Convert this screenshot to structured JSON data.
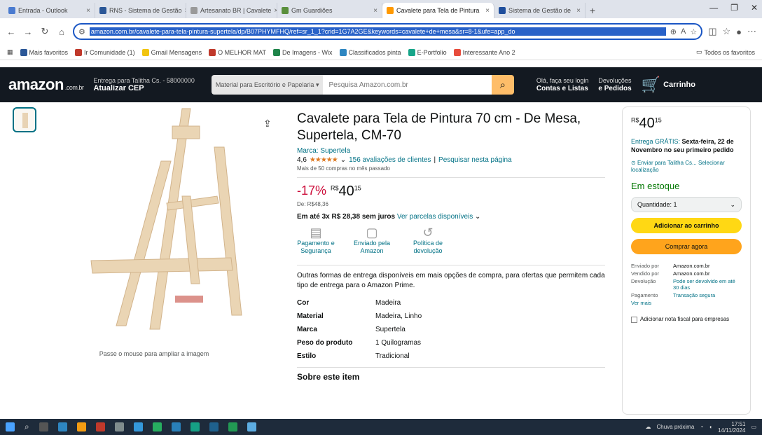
{
  "browser": {
    "tabs": [
      {
        "label": "Entrada - Outlook",
        "active": false
      },
      {
        "label": "RNS - Sistema de Gestão",
        "active": false
      },
      {
        "label": "Artesanato BR | Cavalete",
        "active": false
      },
      {
        "label": "Gm Guardiões",
        "active": false
      },
      {
        "label": "Cavalete para Tela de Pintura",
        "active": true
      },
      {
        "label": "Sistema de Gestão de",
        "active": false
      }
    ],
    "url": "amazon.com.br/cavalete-para-tela-pintura-supertela/dp/B07PHYMFHQ/ref=sr_1_1?crid=1G7A2GE&keywords=cavalete+de+mesa&sr=8-1&ufe=app_do",
    "bookmarks": [
      "Mais favoritos",
      "Ir Comunidade (1)",
      "Gmail Mensagens",
      "O MELHOR MAT",
      "De Imagens - Wix",
      "Classificados pinta",
      "E-Portfolio",
      "Interessante Ano 2"
    ],
    "bookmarks_right": "Todos os favoritos"
  },
  "header": {
    "logo": "amazon",
    "logo_suffix": ".com.br",
    "deliver_line1": "Entrega para Talitha Cs. - 58000000",
    "deliver_line2": "Atualizar CEP",
    "search_category": "Material para Escritório e Papelaria",
    "search_placeholder": "Pesquisa Amazon.com.br",
    "account_line1": "Olá, faça seu login",
    "account_line2": "Contas e Listas",
    "orders_line1": "Devoluções",
    "orders_line2": "e Pedidos",
    "cart_label": "Carrinho",
    "cart_count": "0"
  },
  "product": {
    "title": "Cavalete para Tela de Pintura 70 cm - De Mesa, Supertela, CM-70",
    "brand_link": "Marca: Supertela",
    "rating_value": "4,6",
    "stars": "★★★★★",
    "reviews_link": "156 avaliações de clientes",
    "search_page_link": "Pesquisar nesta página",
    "bought": "Mais de 50 compras no mês passado",
    "discount": "-17%",
    "price_currency": "R$",
    "price_whole": "40",
    "price_cents": "15",
    "old_price": "De: R$48,36",
    "installments": "Em até 3x R$ 28,38 sem juros",
    "installments_link": "Ver parcelas disponíveis",
    "features": [
      {
        "icon": "credit-card-icon",
        "glyph": "▤",
        "label": "Pagamento e Segurança"
      },
      {
        "icon": "box-icon",
        "glyph": "▢",
        "label": "Enviado pela Amazon"
      },
      {
        "icon": "return-icon",
        "glyph": "↺",
        "label": "Política de devolução"
      }
    ],
    "note_text": "Outras formas de entrega disponíveis em mais opções de compra, para ofertas que permitem cada tipo de entrega para o Amazon Prime.",
    "note_link": "mais opções de compra",
    "specs": [
      {
        "key": "Cor",
        "value": "Madeira"
      },
      {
        "key": "Material",
        "value": "Madeira, Linho"
      },
      {
        "key": "Marca",
        "value": "Supertela"
      },
      {
        "key": "Peso do produto",
        "value": "1 Quilogramas"
      },
      {
        "key": "Estilo",
        "value": "Tradicional"
      }
    ],
    "about_heading": "Sobre este item",
    "zoom_hint": "Passe o mouse para ampliar a imagem"
  },
  "buybox": {
    "price_currency": "R$",
    "price_whole": "40",
    "price_cents": "15",
    "delivery_link": "Entrega GRÁTIS:",
    "delivery_text": "Sexta-feira, 22 de Novembro no seu primeiro pedido",
    "location": "Enviar para Talitha Cs... Selecionar localização",
    "stock": "Em estoque",
    "qty_label": "Quantidade: 1",
    "add_cart": "Adicionar ao carrinho",
    "buy_now": "Comprar agora",
    "info": [
      {
        "k": "Enviado por",
        "v": "Amazon.com.br",
        "link": false
      },
      {
        "k": "Vendido por",
        "v": "Amazon.com.br",
        "link": false
      },
      {
        "k": "Devolução",
        "v": "Pode ser devolvido em até 30 dias",
        "link": true
      },
      {
        "k": "Pagamento",
        "v": "Transação segura",
        "link": true
      }
    ],
    "see_more": "Ver mais",
    "gift": "Adicionar nota fiscal para empresas"
  },
  "taskbar": {
    "weather": "Chuva próxima",
    "time": "17:51",
    "date": "14/11/2024"
  },
  "colors": {
    "amazon_dark": "#131921",
    "search_button": "#febd69",
    "add_cart": "#ffd814",
    "buy_now": "#ffa41c",
    "link": "#007185",
    "discount": "#cc0c39",
    "stock": "#007600"
  }
}
